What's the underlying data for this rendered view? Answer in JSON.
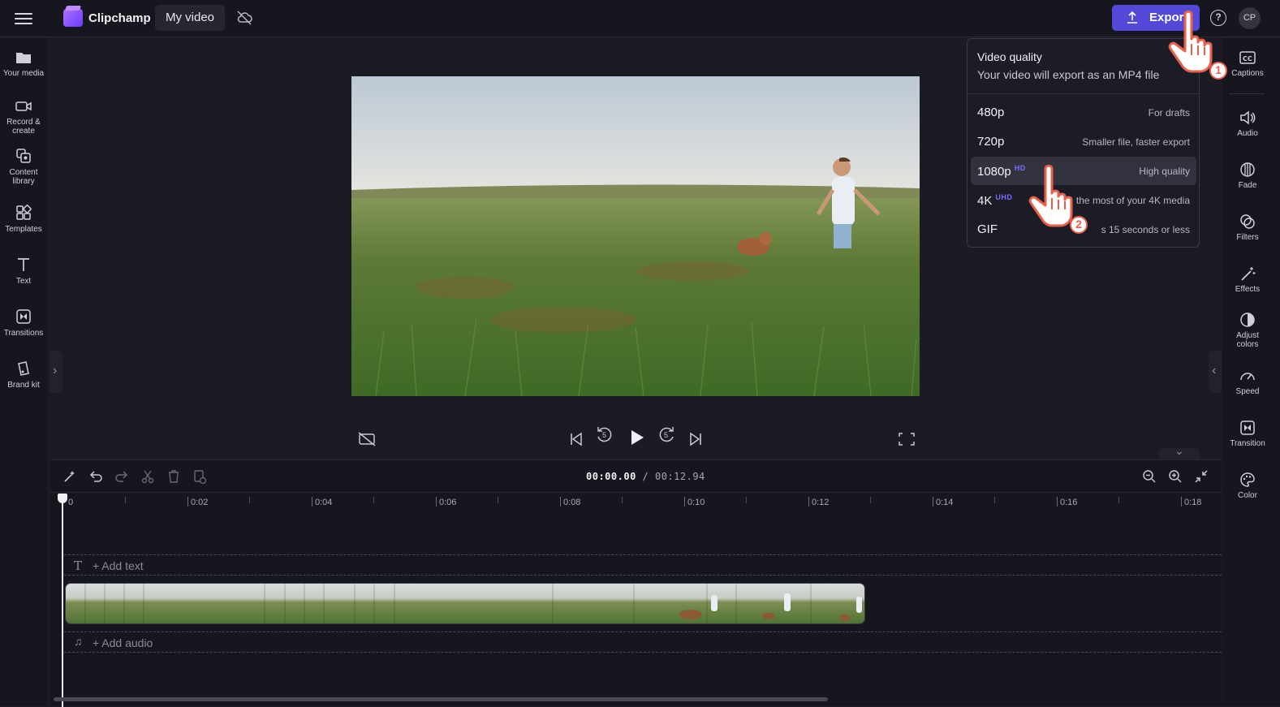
{
  "topbar": {
    "brand": "Clipchamp",
    "project_title": "My video",
    "export_label": "Export",
    "help_label": "?",
    "avatar_initials": "CP"
  },
  "left_sidebar": {
    "items": [
      {
        "label": "Your media",
        "icon": "folder-icon"
      },
      {
        "label": "Record & create",
        "icon": "camera-icon"
      },
      {
        "label": "Content library",
        "icon": "library-icon"
      },
      {
        "label": "Templates",
        "icon": "templates-icon"
      },
      {
        "label": "Text",
        "icon": "text-icon"
      },
      {
        "label": "Transitions",
        "icon": "transitions-icon"
      },
      {
        "label": "Brand kit",
        "icon": "brand-kit-icon"
      }
    ]
  },
  "right_sidebar": {
    "items": [
      {
        "label": "Captions",
        "icon": "captions-icon"
      },
      {
        "label": "Audio",
        "icon": "speaker-icon"
      },
      {
        "label": "Fade",
        "icon": "fade-icon"
      },
      {
        "label": "Filters",
        "icon": "filters-icon"
      },
      {
        "label": "Effects",
        "icon": "magic-wand-icon"
      },
      {
        "label": "Adjust colors",
        "icon": "contrast-icon"
      },
      {
        "label": "Speed",
        "icon": "speedometer-icon"
      },
      {
        "label": "Transition",
        "icon": "transition-icon"
      },
      {
        "label": "Color",
        "icon": "palette-icon"
      }
    ]
  },
  "player": {
    "skip_back_label": "5",
    "skip_forward_label": "5"
  },
  "timeline": {
    "current_time": "00:00.00",
    "total_time": "/ 00:12.94",
    "ruler_labels": [
      "0",
      "0:02",
      "0:04",
      "0:06",
      "0:08",
      "0:10",
      "0:12",
      "0:14",
      "0:16",
      "0:18"
    ],
    "add_text_label": "+ Add text",
    "add_audio_label": "+ Add audio"
  },
  "export_menu": {
    "title": "Video quality",
    "subtitle": "Your video will export as an MP4 file",
    "options": [
      {
        "resolution": "480p",
        "badge": "",
        "description": "For drafts",
        "selected": false
      },
      {
        "resolution": "720p",
        "badge": "",
        "description": "Smaller file, faster export",
        "selected": false
      },
      {
        "resolution": "1080p",
        "badge": "HD",
        "description": "High quality",
        "selected": true
      },
      {
        "resolution": "4K",
        "badge": "UHD",
        "description": "the most of your 4K media",
        "selected": false
      },
      {
        "resolution": "GIF",
        "badge": "",
        "description": "s 15 seconds or less",
        "selected": false
      }
    ]
  },
  "annotations": {
    "step1": "1",
    "step2": "2"
  },
  "colors": {
    "accent": "#5448d8",
    "badge": "#7b6bff",
    "annotation": "#e8604c"
  }
}
